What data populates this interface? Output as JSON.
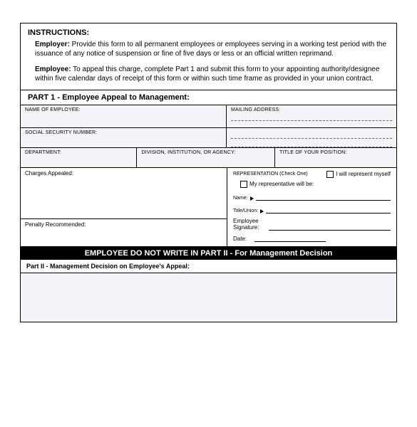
{
  "instructions": {
    "title": "INSTRUCTIONS:",
    "employer_label": "Employer:",
    "employer_text": " Provide this form to all permanent employees or employees serving in a working test period with the issuance of any notice of suspension or fine of five days or less or an official written reprimand.",
    "employee_label": "Employee:",
    "employee_text": " To appeal this charge, complete Part 1 and submit this form to your appointing authority/designee within five calendar days of receipt of this form or within such time frame as provided in your union contract."
  },
  "part1": {
    "heading": "PART 1 - Employee Appeal to Management:",
    "name_label": "NAME OF EMPLOYEE:",
    "mailing_label": "MAILING ADDRESS:",
    "ssn_label": "SOCIAL SECURITY NUMBER:",
    "dept_label": "DEPARTMENT:",
    "division_label": "DIVISION, INSTITUTION, OR AGENCY:",
    "title_label": "TITLE OF YOUR POSITION:",
    "charges_label": "Charges Appealed:",
    "penalty_label": "Penalty Recommended:",
    "rep_heading": "REPRESENTATION (Check One)",
    "rep_self": "I will represent myself",
    "rep_other": "My representative will be:",
    "rep_name_label": "Name:",
    "rep_title_label": "Title/Union:",
    "sig_label": "Employee Signature:",
    "date_label": "Date:"
  },
  "black_bar": "EMPLOYEE DO NOT WRITE IN PART II - For Management Decision",
  "part2": {
    "heading": "Part II - Management Decision on Employee's Appeal:"
  }
}
